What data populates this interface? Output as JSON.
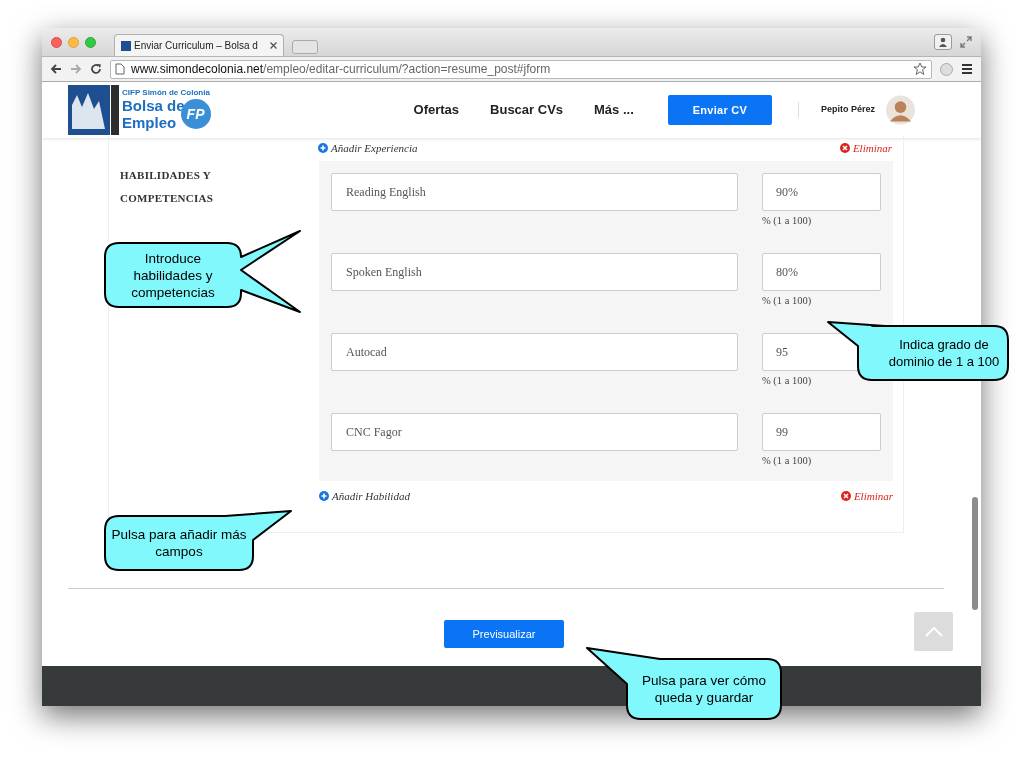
{
  "browser": {
    "tab_title": "Enviar Curriculum – Bolsa d",
    "url_host": "www.simondecolonia.net",
    "url_path": "/empleo/editar-curriculum/?action=resume_post#jform"
  },
  "header": {
    "logo": {
      "school": "CIFP Simón de Colonia",
      "line1": "Bolsa de",
      "line2": "Empleo",
      "badge": "FP"
    },
    "nav": [
      "Ofertas",
      "Buscar CVs",
      "Más ..."
    ],
    "cta": "Enviar CV",
    "user": "Pepito Pérez"
  },
  "previous_section": {
    "add": "Añadir Experiencia",
    "remove": "Eliminar"
  },
  "skills_section": {
    "label": "HABILIDADES Y COMPETENCIAS",
    "skills": [
      {
        "name": "Reading English",
        "value": "90%",
        "hint": "% (1 a 100)"
      },
      {
        "name": "Spoken English",
        "value": "80%",
        "hint": "% (1 a 100)"
      },
      {
        "name": "Autocad",
        "value": "95",
        "hint": "% (1 a 100)"
      },
      {
        "name": "CNC Fagor",
        "value": "99",
        "hint": "% (1 a 100)"
      }
    ],
    "add": "Añadir Habilidad",
    "remove": "Eliminar"
  },
  "preview_button": "Previsualizar",
  "callouts": [
    {
      "text": "Introduce habilidades y competencias"
    },
    {
      "text": "Indica grado de dominio de 1 a 100"
    },
    {
      "text": "Pulsa para añadir más campos"
    },
    {
      "text": "Pulsa para ver cómo queda y guardar"
    }
  ]
}
